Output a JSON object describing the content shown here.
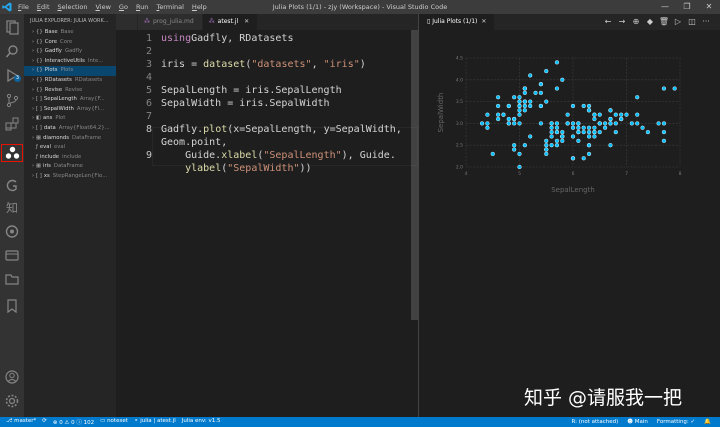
{
  "window": {
    "title": "Julia Plots (1/1) - zjy (Workspace) - Visual Studio Code",
    "menu": [
      {
        "pre": "",
        "u": "F",
        "post": "ile"
      },
      {
        "pre": "",
        "u": "E",
        "post": "dit"
      },
      {
        "pre": "",
        "u": "S",
        "post": "election"
      },
      {
        "pre": "",
        "u": "V",
        "post": "iew"
      },
      {
        "pre": "",
        "u": "G",
        "post": "o"
      },
      {
        "pre": "",
        "u": "R",
        "post": "un"
      },
      {
        "pre": "",
        "u": "T",
        "post": "erminal"
      },
      {
        "pre": "",
        "u": "H",
        "post": "elp"
      }
    ],
    "controls": [
      "—",
      "❐",
      "✕"
    ]
  },
  "activity_bar": {
    "icons": [
      "explorer-icon",
      "search-icon",
      "run-debug-icon",
      "source-control-icon",
      "extensions-icon",
      "julia-icon",
      "git-graph-icon",
      "zhihu-icon",
      "remote-icon",
      "docker-icon",
      "folder-icon",
      "bookmark-icon",
      "account-icon",
      "settings-icon"
    ],
    "badge": "3",
    "selected": "julia-icon"
  },
  "sidebar": {
    "header": "JULIA EXPLORER: JULIA WORK...",
    "items": [
      {
        "chev": "›",
        "icon": "{}",
        "name": "Base",
        "type": "Base",
        "sel": false
      },
      {
        "chev": "›",
        "icon": "{}",
        "name": "Core",
        "type": "Core",
        "sel": false
      },
      {
        "chev": "›",
        "icon": "{}",
        "name": "Gadfly",
        "type": "Gadfly",
        "sel": false
      },
      {
        "chev": "›",
        "icon": "{}",
        "name": "InteractiveUtils",
        "type": "Inte...",
        "sel": false
      },
      {
        "chev": "›",
        "icon": "{}",
        "name": "Plots",
        "type": "Plots",
        "sel": true
      },
      {
        "chev": "›",
        "icon": "{}",
        "name": "RDatasets",
        "type": "RDatasets",
        "sel": false
      },
      {
        "chev": "›",
        "icon": "{}",
        "name": "Revise",
        "type": "Revise",
        "sel": false
      },
      {
        "chev": "›",
        "icon": "[ ]",
        "name": "SepalLength",
        "type": "Array{F...",
        "sel": false
      },
      {
        "chev": "›",
        "icon": "[ ]",
        "name": "SepalWidth",
        "type": "Array{Fl...",
        "sel": false
      },
      {
        "chev": "›",
        "icon": "◧",
        "name": "ans",
        "type": "Plot",
        "sel": false
      },
      {
        "chev": "›",
        "icon": "[ ]",
        "name": "data",
        "type": "Array{Float64,2}...",
        "sel": false
      },
      {
        "chev": "›",
        "icon": "▦",
        "name": "diamonds",
        "type": "DataFrame",
        "sel": false
      },
      {
        "chev": "",
        "icon": "ƒ",
        "name": "eval",
        "type": "eval",
        "sel": false
      },
      {
        "chev": "",
        "icon": "ƒ",
        "name": "include",
        "type": "include",
        "sel": false
      },
      {
        "chev": "›",
        "icon": "▦",
        "name": "iris",
        "type": "DataFrame",
        "sel": false
      },
      {
        "chev": "›",
        "icon": "[ ]",
        "name": "xs",
        "type": "StepRangeLen{Flo...",
        "sel": false
      }
    ]
  },
  "editor": {
    "tabs": [
      {
        "name": "",
        "active": false
      },
      {
        "name": "prog_julia.md",
        "active": false
      },
      {
        "name": "atest.jl",
        "active": true
      }
    ],
    "lines": [
      {
        "n": "1",
        "tokens": [
          [
            "kw",
            "using"
          ],
          [
            "",
            "Gadfly, RDatasets"
          ]
        ]
      },
      {
        "n": "2",
        "tokens": []
      },
      {
        "n": "3",
        "tokens": [
          [
            "",
            "iris = "
          ],
          [
            "fn",
            "dataset"
          ],
          [
            "",
            "("
          ],
          [
            "st",
            "\"datasets\""
          ],
          [
            "",
            ", "
          ],
          [
            "st",
            "\"iris\""
          ],
          [
            "",
            ")"
          ]
        ]
      },
      {
        "n": "4",
        "tokens": []
      },
      {
        "n": "5",
        "tokens": [
          [
            "",
            "SepalLength = iris.SepalLength"
          ]
        ]
      },
      {
        "n": "6",
        "tokens": [
          [
            "",
            "SepalWidth = iris.SepalWidth"
          ]
        ]
      },
      {
        "n": "7",
        "tokens": []
      },
      {
        "n": "8",
        "tokens": [
          [
            "",
            "Gadfly."
          ],
          [
            "fn",
            "plot"
          ],
          [
            "",
            "(x=SepalLength, y=SepalWidth,"
          ]
        ]
      },
      {
        "n": "",
        "tokens": [
          [
            "",
            "Geom.point,"
          ]
        ]
      },
      {
        "n": "9",
        "tokens": [
          [
            "",
            "    Guide."
          ],
          [
            "fn",
            "xlabel"
          ],
          [
            "",
            "("
          ],
          [
            "st",
            "\"SepalLength\""
          ],
          [
            "",
            "), Guide."
          ]
        ]
      },
      {
        "n": "",
        "tokens": [
          [
            "",
            "    "
          ],
          [
            "fn",
            "ylabel"
          ],
          [
            "",
            "("
          ],
          [
            "st",
            "\"SepalWidth\""
          ],
          [
            "",
            "))"
          ]
        ]
      }
    ]
  },
  "plot_pane": {
    "tab": "Julia Plots (1/1)",
    "toolbar": [
      "←",
      "→",
      "⊕",
      "◆",
      "🗑",
      "▷",
      "◫",
      "···"
    ]
  },
  "chart_data": {
    "type": "scatter",
    "xlabel": "SepalLength",
    "ylabel": "SepalWidth",
    "xlim": [
      4,
      8
    ],
    "ylim": [
      2,
      4.5
    ],
    "xticks": [
      "4",
      "5",
      "6",
      "7",
      "8"
    ],
    "yticks": [
      "2.0",
      "2.5",
      "3.0",
      "3.5",
      "4.0",
      "4.5"
    ],
    "grid": true,
    "point_color": "#00bfff",
    "x": [
      5.1,
      4.9,
      4.7,
      4.6,
      5.0,
      5.4,
      4.6,
      5.0,
      4.4,
      4.9,
      5.4,
      4.8,
      4.8,
      4.3,
      5.8,
      5.7,
      5.4,
      5.1,
      5.7,
      5.1,
      5.4,
      5.1,
      4.6,
      5.1,
      4.8,
      5.0,
      5.0,
      5.2,
      5.2,
      4.7,
      4.8,
      5.4,
      5.2,
      5.5,
      4.9,
      5.0,
      5.5,
      4.9,
      4.4,
      5.1,
      5.0,
      4.5,
      4.4,
      5.0,
      5.1,
      4.8,
      5.1,
      4.6,
      5.3,
      5.0,
      7.0,
      6.4,
      6.9,
      5.5,
      6.5,
      5.7,
      6.3,
      4.9,
      6.6,
      5.2,
      5.0,
      5.9,
      6.0,
      6.1,
      5.6,
      6.7,
      5.6,
      5.8,
      6.2,
      5.6,
      5.9,
      6.1,
      6.3,
      6.1,
      6.4,
      6.6,
      6.8,
      6.7,
      6.0,
      5.7,
      5.5,
      5.5,
      5.8,
      6.0,
      5.4,
      6.0,
      6.7,
      6.3,
      5.6,
      5.5,
      5.5,
      6.1,
      5.8,
      5.0,
      5.6,
      5.7,
      5.7,
      6.2,
      5.1,
      5.7,
      6.3,
      5.8,
      7.1,
      6.3,
      6.5,
      7.6,
      4.9,
      7.3,
      6.7,
      7.2,
      6.5,
      6.4,
      6.8,
      5.7,
      5.8,
      6.4,
      6.5,
      7.7,
      7.7,
      6.0,
      6.9,
      5.6,
      7.7,
      6.3,
      6.7,
      7.2,
      6.2,
      6.1,
      6.4,
      7.2,
      7.4,
      7.9,
      6.4,
      6.3,
      6.1,
      7.7,
      6.3,
      6.4,
      6.0,
      6.9,
      6.7,
      6.9,
      5.8,
      6.8,
      6.7,
      6.7,
      6.3,
      6.5,
      6.2,
      5.9
    ],
    "y": [
      3.5,
      3.0,
      3.2,
      3.1,
      3.6,
      3.9,
      3.4,
      3.4,
      2.9,
      3.1,
      3.7,
      3.4,
      3.0,
      3.0,
      4.0,
      4.4,
      3.9,
      3.5,
      3.8,
      3.8,
      3.4,
      3.7,
      3.6,
      3.3,
      3.4,
      3.0,
      3.4,
      3.5,
      3.4,
      3.2,
      3.1,
      3.4,
      4.1,
      4.2,
      3.1,
      3.2,
      3.5,
      3.6,
      3.0,
      3.4,
      3.5,
      2.3,
      3.2,
      3.5,
      3.8,
      3.0,
      3.8,
      3.2,
      3.7,
      3.3,
      3.2,
      3.2,
      3.1,
      2.3,
      2.8,
      2.8,
      3.3,
      2.4,
      2.9,
      2.7,
      2.0,
      3.0,
      2.2,
      2.9,
      2.9,
      3.1,
      3.0,
      2.7,
      2.2,
      2.5,
      3.2,
      2.8,
      2.5,
      2.8,
      2.9,
      3.0,
      2.8,
      3.0,
      2.9,
      2.6,
      2.4,
      2.4,
      2.7,
      2.7,
      3.0,
      3.4,
      3.1,
      2.3,
      3.0,
      2.5,
      2.6,
      3.0,
      2.6,
      2.3,
      2.7,
      3.0,
      2.9,
      2.9,
      2.5,
      2.8,
      3.3,
      2.7,
      3.0,
      2.9,
      3.0,
      3.0,
      2.5,
      2.9,
      2.5,
      3.6,
      3.2,
      2.7,
      3.0,
      2.5,
      2.8,
      3.2,
      3.0,
      3.8,
      2.6,
      2.2,
      3.2,
      2.8,
      2.8,
      2.7,
      3.3,
      3.2,
      2.8,
      3.0,
      2.8,
      3.0,
      2.8,
      3.8,
      2.8,
      2.8,
      2.6,
      3.0,
      3.4,
      3.1,
      3.0,
      3.1,
      3.1,
      3.1,
      2.7,
      3.2,
      3.3,
      3.0,
      2.5,
      3.0,
      3.4,
      3.0
    ]
  },
  "watermark": "知乎 @请服我一把",
  "status_bar": {
    "left": [
      "⎇ master*",
      "⟳",
      "⊗ 0 ⚠ 0 ⓘ 102",
      "▭ noteset",
      "⚬ julia | atest.jl",
      "Julia env: v1.5"
    ],
    "right": [
      "R: (not attached)",
      "☻ Main",
      "Formatting: ✓",
      "🔔"
    ]
  }
}
